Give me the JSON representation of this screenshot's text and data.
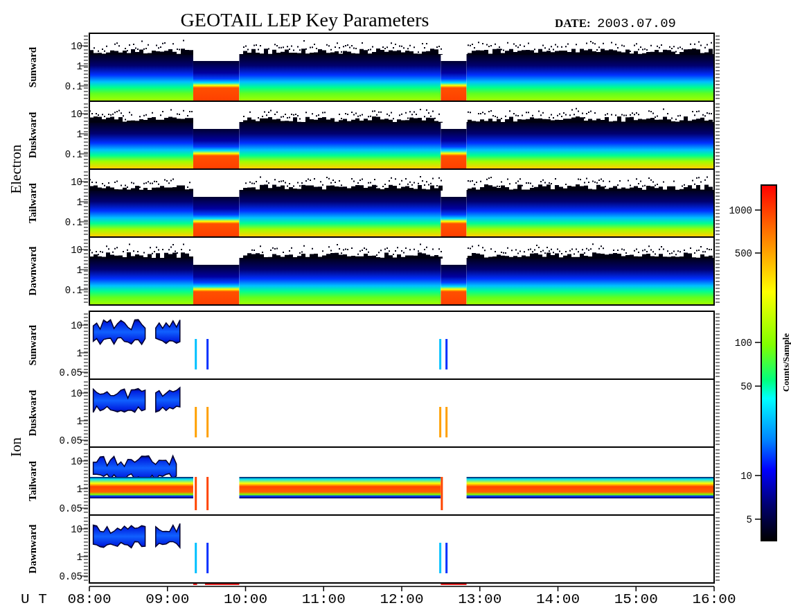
{
  "title": "GEOTAIL LEP Key Parameters",
  "date_label": "DATE:",
  "date": "2003.07.09",
  "groups": [
    {
      "label": "Electron",
      "kind": "electron",
      "panels": [
        {
          "label": "Sunward",
          "yticks": [
            "10",
            "1",
            "0.1"
          ]
        },
        {
          "label": "Duskward",
          "yticks": [
            "10",
            "1",
            "0.1"
          ]
        },
        {
          "label": "Tailward",
          "yticks": [
            "10",
            "1",
            "0.1"
          ]
        },
        {
          "label": "Dawnward",
          "yticks": [
            "10",
            "1",
            "0.1"
          ]
        }
      ]
    },
    {
      "label": "Ion",
      "kind": "ion",
      "panels": [
        {
          "label": "Sunward",
          "yticks": [
            "10",
            "1",
            "0.05"
          ]
        },
        {
          "label": "Duskward",
          "yticks": [
            "10",
            "1",
            "0.05"
          ]
        },
        {
          "label": "Tailward",
          "yticks": [
            "10",
            "1",
            "0.05"
          ]
        },
        {
          "label": "Dawnward",
          "yticks": [
            "10",
            "1",
            "0.05"
          ]
        }
      ]
    }
  ],
  "time_axis": {
    "label": "U T",
    "ticks": [
      "08:00",
      "09:00",
      "10:00",
      "11:00",
      "12:00",
      "13:00",
      "14:00",
      "15:00",
      "16:00"
    ]
  },
  "colorbar": {
    "label": "Counts/Sample",
    "ticks": [
      "1000",
      "500",
      "100",
      "50",
      "10",
      "5"
    ]
  }
}
